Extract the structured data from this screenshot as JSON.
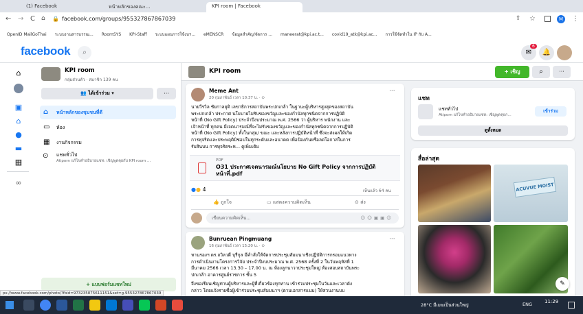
{
  "browser": {
    "tabs": [
      "(1) Facebook",
      "หน้าหลักของคณะ...",
      "KPI room | Facebook"
    ],
    "url": "facebook.com/groups/955327867867039",
    "bookmarks": [
      "OpenID MailGoThai",
      "ระบบงานสารบรรณ...",
      "RoomSYS",
      "KPI-Staff",
      "ระบบแผนการใช้งบฯ...",
      "eMENSCR",
      "ข้อมูลสำคัญ/จัดการ ...",
      "maneerat@kpi.ac.t...",
      "covid19_atk@kpi.ac...",
      "การใช้จัดทำใน IP กับ A..."
    ],
    "status_url": "ps://www.facebook.com/photo/?fbid=973235875611151&set=g.955327867867039"
  },
  "fb": {
    "logo": "facebook",
    "notification_count": "6"
  },
  "group": {
    "name": "KPI room",
    "meta": "กลุ่มส่วนตัว · สมาชิก 139 คน",
    "joined_label": "ได้เข้าร่วม",
    "more": "···",
    "nav": [
      "หน้าหลักของชุมชนที่ดี",
      "ห้อง",
      "งานกิจกรรม"
    ],
    "chat_title": "แชททั่วไป",
    "chat_sub": "Atiporn แก้ไขคำอธิบายแชท: เชิญพูดคุยกับ KPI room ...",
    "new_chat": "+ แบบฟอร์มแชทใหม่"
  },
  "titlebar": {
    "name": "KPI room",
    "invite": "+ เชิญ",
    "search_icon": "search-icon",
    "more": "···"
  },
  "post1": {
    "author": "Meme Ant",
    "time": "20 กุมภาพันธ์ เวลา 10:37 น. · ⊙",
    "lines": [
      "นายวีรวิล ชัยกาลยุติ เลขาธิการสถาบันพระปกเกล้า ในฐานะผู้บริหารสูงสุดของสถาบัน",
      "พระปกเกล้า ประกาศ นโยบายไม่รับของขวัญและของกำนัลทุกชนิดจากการปฏิบัติ",
      "หน้าที่ (No Gift Policy) ประจำปีงบประมาณ พ.ศ. 2566 ว่า ผู้บริหาร พนักงาน และ",
      "เจ้าหน้าที่ ทุกคน มีเจตนารมณ์ที่จะไม่รับของขวัญและของกำนัลทุกชนิดจากการปฏิบัติ",
      "หน้าที่ (No Gift Policy) ทั้งในกลุ่ม/ ขณะ และหลังการปฏิบัติหน้าที่ ซึ่งจะส่งผลให้เกิด",
      "การทุจริตและประพฤติมิชอบในทุกระดับและอนาคต เพื่อป้องกันหรือลดโอกาสในการ",
      "รับสินบน การทุจริตระห... ดูเพิ่มเติม"
    ],
    "pdf_label": "PDF",
    "pdf_title": "O31 ประกาศเจตนารมณ์นโยบาย No Gift Policy จากการปฏิบัติหน้าที่.pdf",
    "reactions": "4",
    "seen": "เห็นแล้ว 64 คน",
    "like": "ถูกใจ",
    "comment": "แสดงความคิดเห็น",
    "share": "ส่ง",
    "comment_placeholder": "เขียนความคิดเห็น..."
  },
  "post2": {
    "author": "Bunruean Pingmuang",
    "time": "16 กุมภาพันธ์ เวลา 15:20 น. · ⊙",
    "lines": [
      "ทานรองฯ ดร.ถวิลวดี บุรีกุล มีคำสั่งให้จัดการประชุมสัมมนาเชิงปฏิบัติการกรอบแนวทาง",
      "การดำเนินงานโครงการวิจัย ประจำปีงบประมาณ พ.ศ. 2568 ครั้งที่ 2 ในวันพฤหัสที่ 1",
      "มีนาคม 2566 เวลา 13.30 – 17.00 น. ณ ห้องลูกนาวาประชุมใหญ่ ห้องสอบสถาบันพระ",
      "ปกเกล้า อาคารศูนย์ราชการ ชั้น 5",
      "",
      "จึงขอเรียนเชิญท่านผู้บริหารและผู้ที่เกี่ยวข้องทุกท่าน เข้าร่วมประชุมในวันและเวลาดัง",
      "กล่าว โดยแจ้งรายชื่อผู้เข้าร่วมประชุมสัมมนาฯ (ตามเอกสารแนบ) ให้สวนงานบบ"
    ]
  },
  "chats_card": {
    "title": "แชท",
    "chat_name": "แชททั่วไป",
    "chat_sub": "Atiporn แก้ไขคำอธิบายแชท: เชิญพูดคุยก...",
    "join": "เข้าร่วม",
    "see_all": "ดูทั้งหมด"
  },
  "media_card": {
    "title": "สื่อล่าสุด",
    "tiles": [
      "product-boxes",
      "acuvue-box",
      "vase-flowers",
      "green-vegetables"
    ],
    "acuvue_text": "ACUVUE MOIST"
  },
  "taskbar": {
    "weather": "28°C มีเมฆเป็นส่วนใหญ่",
    "time": "11:29",
    "lang": "ENG"
  },
  "colors": {
    "fb_blue": "#1877f2",
    "green": "#42b72a",
    "taskbar": "#1f2a3a"
  }
}
